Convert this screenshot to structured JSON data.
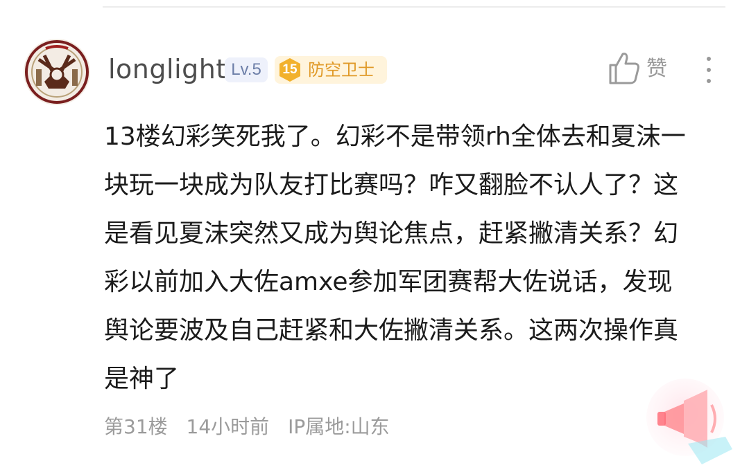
{
  "comment": {
    "username": "longlight",
    "level": "Lv.5",
    "fan_badge": {
      "number": "15",
      "title": "防空卫士"
    },
    "like_label": "赞",
    "content_lines": [
      "13楼幻彩笑死我了。幻彩不是带领rh全体去和夏沫一",
      "块玩一块成为队友打比赛吗？咋又翻脸不认人了？这",
      "是看见夏沫突然又成为舆论焦点，赶紧撇清关系？幻",
      "彩以前加入大佐amxe参加军团赛帮大佐说话，发现",
      "舆论要波及自己赶紧和大佐撇清关系。这两次操作真",
      "是神了"
    ],
    "floor": "第31楼",
    "time": "14小时前",
    "ip_location": "IP属地:山东"
  },
  "icons": {
    "avatar": "avatar-emblem-icon",
    "like": "thumb-up-icon",
    "more": "more-vertical-icon",
    "floating": "megaphone-icon"
  },
  "colors": {
    "username": "#4d4d4d",
    "level_badge_bg": "#eef1fb",
    "fan_badge_bg": "#fff4dc",
    "fan_badge_text": "#e09a28",
    "meta_text": "#9b9b9b"
  }
}
